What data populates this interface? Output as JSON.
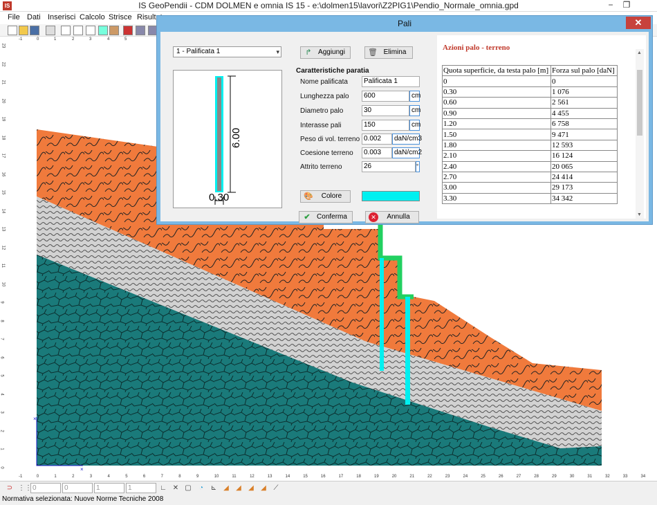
{
  "window": {
    "title": "IS GeoPendii - CDM DOLMEN e omnia IS 15 - e:\\dolmen15\\lavori\\Z2PIG1\\Pendio_Normale_omnia.gpd",
    "minimize": "−",
    "restore": "❐"
  },
  "menu": [
    "File",
    "Dati",
    "Inserisci",
    "Calcolo",
    "Strisce",
    "Risultat"
  ],
  "ruler": {
    "top": [
      "-1",
      "0",
      "1",
      "2",
      "3",
      "4",
      "5",
      "6"
    ],
    "left": [
      "23",
      "22",
      "21",
      "20",
      "19",
      "18",
      "17",
      "16",
      "15",
      "14",
      "13",
      "12",
      "11",
      "10",
      "9",
      "8",
      "7",
      "6",
      "5",
      "4",
      "3",
      "2",
      "1",
      "0"
    ],
    "bottom": [
      "-1",
      "0",
      "1",
      "2",
      "3",
      "4",
      "5",
      "6",
      "7",
      "8",
      "9",
      "10",
      "11",
      "12",
      "13",
      "14",
      "15",
      "16",
      "17",
      "18",
      "19",
      "20",
      "21",
      "22",
      "23",
      "24",
      "25",
      "26",
      "27",
      "28",
      "29",
      "30",
      "31",
      "32",
      "33",
      "34"
    ]
  },
  "status": {
    "fields": [
      "0",
      "0",
      "1",
      "1"
    ],
    "normativa": "Normativa selezionata: Nuove Norme Tecniche 2008"
  },
  "dialog": {
    "title": "Pali",
    "close": "✕",
    "selector": "1 - Palificata 1",
    "add_label": "Aggiungi",
    "delete_label": "Elimina",
    "preview": {
      "length_label": "6.00",
      "diameter_label": "0.30"
    },
    "section_title": "Caratteristiche paratia",
    "fields": {
      "name_label": "Nome palificata",
      "name_value": "Palificata 1",
      "length_label": "Lunghezza  palo",
      "length_value": "600",
      "length_unit": "cm",
      "diameter_label": "Diametro palo",
      "diameter_value": "30",
      "diameter_unit": "cm",
      "spacing_label": "Interasse pali",
      "spacing_value": "150",
      "spacing_unit": "cm",
      "weight_label": "Peso di vol. terreno",
      "weight_value": "0.002",
      "weight_unit": "daN/cm3",
      "cohesion_label": "Coesione terreno",
      "cohesion_value": "0.003",
      "cohesion_unit": "daN/cm2",
      "friction_label": "Attrito terreno",
      "friction_value": "26",
      "friction_unit": "°"
    },
    "color_label": "Colore",
    "color_value": "#00f0f0",
    "confirm_label": "Conferma",
    "cancel_label": "Annulla",
    "results": {
      "title": "Azioni palo - terreno",
      "col1": "Quota superficie, da testa palo [m]",
      "col2": "Forza sul palo [daN]",
      "rows": [
        [
          "0",
          "0"
        ],
        [
          "0.30",
          "1 076"
        ],
        [
          "0.60",
          "2 561"
        ],
        [
          "0.90",
          "4 455"
        ],
        [
          "1.20",
          "6 758"
        ],
        [
          "1.50",
          "9 471"
        ],
        [
          "1.80",
          "12 593"
        ],
        [
          "2.10",
          "16 124"
        ],
        [
          "2.40",
          "20 065"
        ],
        [
          "2.70",
          "24 414"
        ],
        [
          "3.00",
          "29 173"
        ],
        [
          "3.30",
          "34 342"
        ]
      ]
    }
  },
  "colors": {
    "clay": "#f07a3c",
    "gravel": "#c8c8c8",
    "rock": "#1a7a7a",
    "pile": "#00f0f0",
    "wall": "#22d060",
    "dialog_frame": "#7ab8e4",
    "close": "#c7423c",
    "result_title": "#c0392b"
  }
}
